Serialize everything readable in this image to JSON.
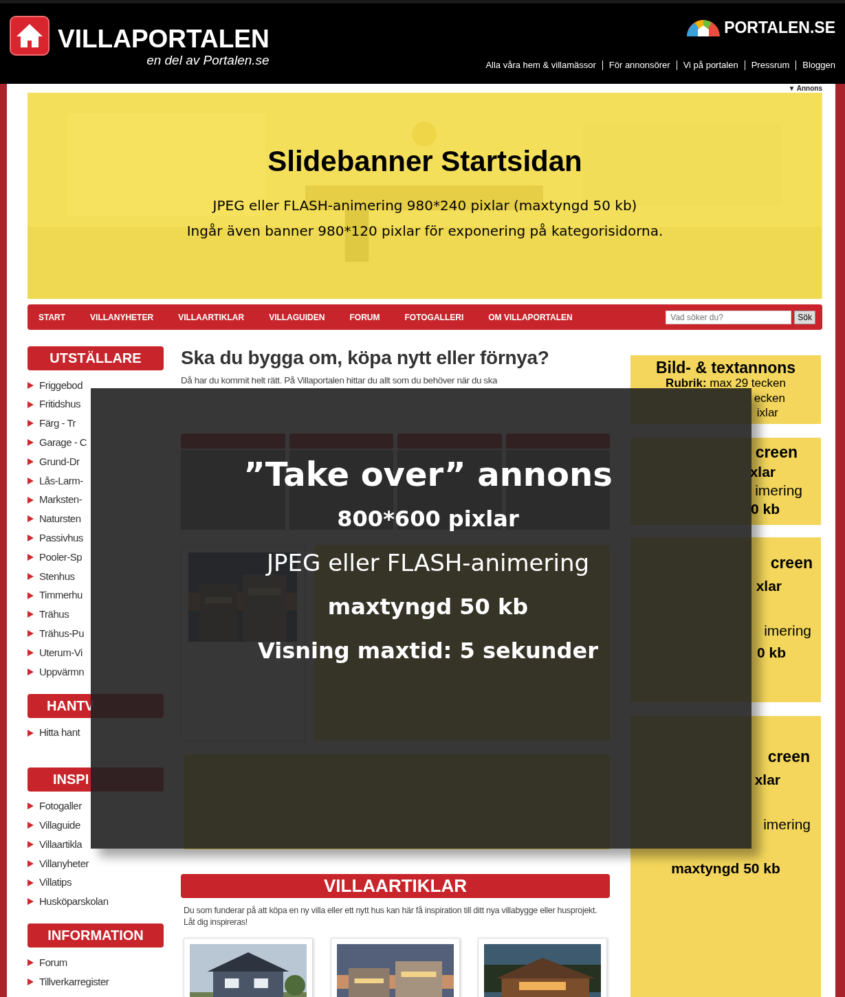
{
  "header": {
    "title": "VILLAPORTALEN",
    "tagline": "en del av Portalen.se",
    "brand": "PORTALEN.SE",
    "links": [
      "Alla våra hem & villamässor",
      "För annonsörer",
      "Vi på portalen",
      "Pressrum",
      "Bloggen"
    ]
  },
  "ad_label": "▼ Annons",
  "slidebanner": {
    "title": "Slidebanner Startsidan",
    "lines": [
      "JPEG eller FLASH-animering 980*240 pixlar (maxtyngd 50 kb)",
      "Ingår även banner 980*120 pixlar för exponering på kategorisidorna."
    ]
  },
  "nav": {
    "items": [
      "START",
      "VILLANYHETER",
      "VILLAARTIKLAR",
      "VILLAGUIDEN",
      "FORUM",
      "FOTOGALLERI",
      "OM VILLAPORTALEN"
    ],
    "search": {
      "placeholder": "Vad söker du?"
    },
    "search_button": "Sök"
  },
  "sidebar": [
    {
      "heading": "UTSTÄLLARE",
      "items": [
        "Friggebod",
        "Fritidshus",
        "Färg - Tr",
        "Garage - C",
        "Grund-Dr",
        "Lås-Larm-",
        "Marksten-",
        "Natursten",
        "Passivhus",
        "Pooler-Sp",
        "Stenhus",
        "Timmerhu",
        "Trähus",
        "Trähus-Pu",
        "Uterum-Vi",
        "Uppvärmn"
      ]
    },
    {
      "heading": "HANTV",
      "items": [
        "Hitta hant"
      ]
    },
    {
      "heading": "INSPI",
      "items": [
        "Fotogaller",
        "Villaguide",
        "Villaartikla",
        "Villanyheter",
        "Villatips",
        "Husköparskolan"
      ]
    },
    {
      "heading": "INFORMATION",
      "items": [
        "Forum",
        "Tillverkarregister"
      ]
    }
  ],
  "intro": {
    "heading": "Ska du bygga om, köpa nytt eller förnya?",
    "text": "Då har du kommit helt rätt. På Villaportalen hittar du allt som du behöver när du ska"
  },
  "articles": {
    "heading": "VILLAARTIKLAR",
    "text": "Du som funderar på att köpa en ny villa eller ett nytt hus kan här få inspiration till ditt nya villabygge eller husprojekt. Låt dig inspireras!"
  },
  "ad_boxes": [
    {
      "lines": [
        {
          "kind": "title",
          "text": "Bild- & textannons"
        },
        {
          "kind": "label",
          "text": "**Rubrik:** max 29 tecken"
        },
        {
          "kind": "label",
          "text": "ecken"
        },
        {
          "kind": "label",
          "text": "ixlar"
        }
      ]
    },
    {
      "lines": [
        {
          "kind": "title",
          "text": "creen"
        },
        {
          "kind": "bold",
          "text": "xlar"
        },
        {
          "kind": "plain",
          "text": "imering"
        },
        {
          "kind": "bold",
          "text": "0 kb"
        }
      ]
    },
    {
      "lines": [
        {
          "kind": "title",
          "text": "creen"
        },
        {
          "kind": "bold",
          "text": "xlar"
        },
        {
          "kind": "plain",
          "text": "imering"
        },
        {
          "kind": "bold",
          "text": "0 kb"
        }
      ]
    },
    {
      "lines": [
        {
          "kind": "title",
          "text": "creen"
        },
        {
          "kind": "bold",
          "text": "xlar"
        },
        {
          "kind": "plain",
          "text": "imering"
        },
        {
          "kind": "bold",
          "text": "maxtyngd 50 kb"
        }
      ]
    }
  ],
  "takeover": {
    "title": "”Take over” annons",
    "lines": [
      {
        "text": "800*600 pixlar",
        "bold": true
      },
      {
        "text": "JPEG eller FLASH-animering",
        "bold": false
      },
      {
        "text": "maxtyngd 50 kb",
        "bold": true
      },
      {
        "text": "Visning maxtid: 5 sekunder",
        "bold": true
      }
    ]
  }
}
